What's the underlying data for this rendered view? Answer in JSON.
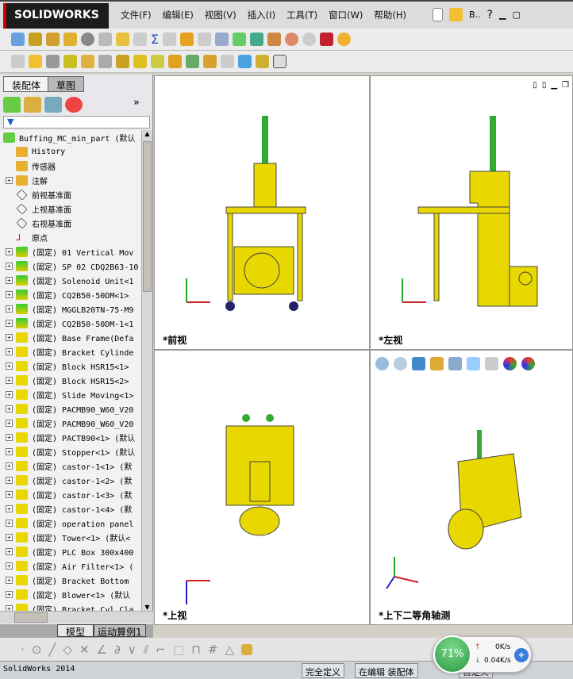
{
  "app": {
    "logo": "SOLIDWORKS",
    "menu": [
      "文件(F)",
      "编辑(E)",
      "视图(V)",
      "插入(I)",
      "工具(T)",
      "窗口(W)",
      "帮助(H)"
    ],
    "search_short": "B.."
  },
  "panel": {
    "tabs": [
      "装配体",
      "草图"
    ],
    "bottom_tabs": [
      "模型",
      "运动算例1"
    ]
  },
  "tree": {
    "root": "Buffing_MC_min_part  (默认",
    "features": [
      "History",
      "传感器",
      "注解",
      "前视基准面",
      "上视基准面",
      "右视基准面",
      "原点"
    ],
    "components": [
      "(固定) 01 Vertical Mov",
      "(固定) SP 02 CDQ2B63-10",
      "(固定) Solenoid Unit<1",
      "(固定) CQ2B50-50DM<1>",
      "(固定) MGGLB20TN-75-M9",
      "(固定) CQ2B50-50DM-1<1",
      "(固定) Base Frame(Defa",
      "(固定) Bracket Cylinde",
      "(固定) Block HSR15<1>",
      "(固定) Block HSR15<2>",
      "(固定) Slide Moving<1>",
      "(固定) PACMB90_W60_V20",
      "(固定) PACMB90_W60_V20",
      "(固定) PACTB90<1> (默认",
      "(固定) Stopper<1> (默认",
      "(固定) castor-1<1> (默",
      "(固定) castor-1<2> (默",
      "(固定) castor-1<3> (默",
      "(固定) castor-1<4> (默",
      "(固定) operation panel",
      "(固定) Tower<1> (默认<",
      "(固定) PLC Box 300x400",
      "(固定) Air Filter<1> (",
      "(固定) Bracket Bottom",
      "(固定) Blower<1> (默认",
      "(固定) Bracket Cyl Cla"
    ]
  },
  "viewports": {
    "front": "*前视",
    "left": "*左视",
    "top": "*上视",
    "iso": "*上下二等角轴测"
  },
  "status": {
    "app": "SolidWorks 2014",
    "defined": "完全定义",
    "editing": "在编辑 装配体",
    "custom": "自定义"
  },
  "net": {
    "percent": "71%",
    "up": "0K/s",
    "down": "0.04K/s"
  },
  "colors": {
    "part": "#e8d800",
    "bg": "#ffffff"
  }
}
